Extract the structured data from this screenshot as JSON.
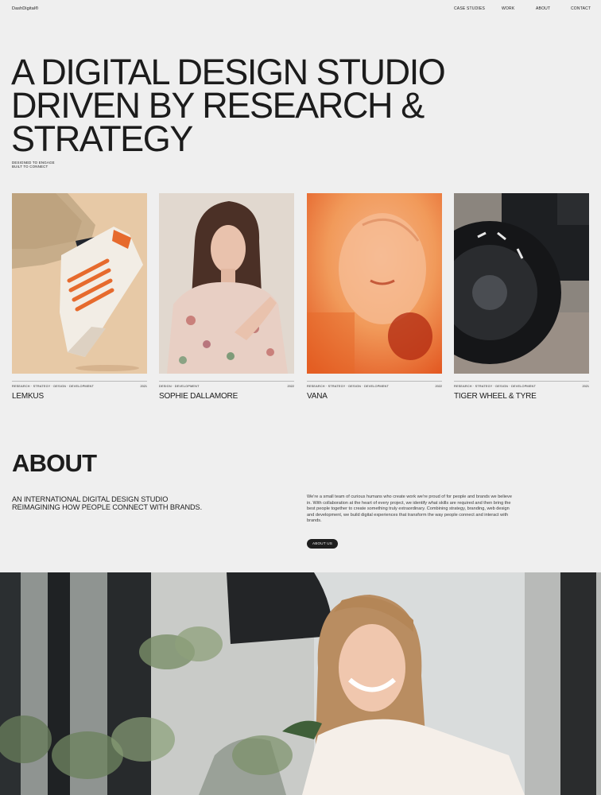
{
  "header": {
    "logo": "DashDigital®",
    "nav": [
      "CASE STUDIES",
      "WORK",
      "ABOUT",
      "CONTACT"
    ]
  },
  "hero": {
    "lines": [
      "A DIGITAL DESIGN STUDIO",
      "DRIVEN BY RESEARCH &",
      "STRATEGY"
    ],
    "tagline": [
      "DESIGNED TO ENGAGE",
      "BUILT TO CONNECT"
    ]
  },
  "projects": [
    {
      "num": "01",
      "tags": "RESEARCH  ·  STRATEGY  ·  DESIGN  ·  DEVELOPMENT",
      "year": "2021",
      "title": "LEMKUS"
    },
    {
      "num": "02",
      "tags": "DESIGN  ·  DEVELOPMENT",
      "year": "2022",
      "title": "SOPHIE DALLAMORE"
    },
    {
      "num": "03",
      "tags": "RESEARCH  ·  STRATEGY  ·  DESIGN  ·  DEVELOPMENT",
      "year": "2022",
      "title": "VANA"
    },
    {
      "num": "04",
      "tags": "RESEARCH  ·  STRATEGY  ·  DESIGN  ·  DEVELOPMENT",
      "year": "2021",
      "title": "TIGER WHEEL & TYRE"
    }
  ],
  "about": {
    "title": "ABOUT",
    "lead": [
      "AN INTERNATIONAL DIGITAL DESIGN STUDIO",
      "REIMAGINING HOW PEOPLE CONNECT WITH BRANDS."
    ],
    "body": "We're a small team of curious humans who create work we're proud of for people and brands we believe in. With collaboration at the heart of every project, we identify what skills are required and then bring the best people together to create something truly extraordinary. Combining strategy, branding, web design and development, we build digital experiences that transform the way people connect and interact with brands.",
    "button": "ABOUT US"
  },
  "colors": {
    "background": "#efefef",
    "text": "#1c1c1c",
    "button": "#1e1e1e"
  }
}
